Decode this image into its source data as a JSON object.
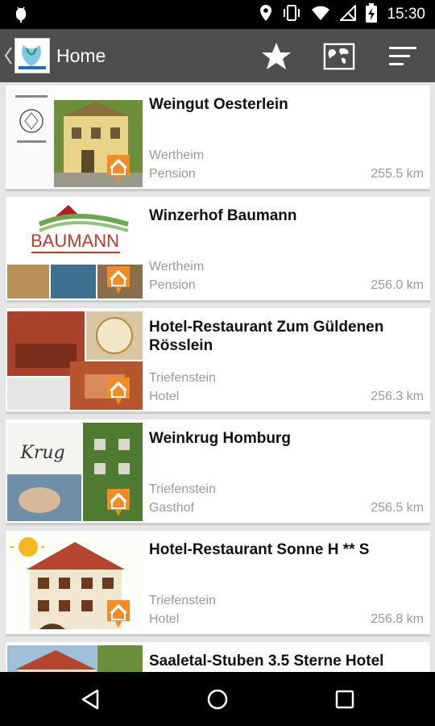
{
  "status_bar": {
    "time": "15:30",
    "icons": [
      "android-debug-icon",
      "location-icon",
      "vibrate-icon",
      "wifi-icon",
      "no-signal-icon",
      "battery-charging-icon"
    ]
  },
  "app_bar": {
    "back_icon": "chevron-left-icon",
    "title": "Home",
    "actions": [
      "star-icon",
      "map-icon",
      "sort-icon"
    ]
  },
  "listings": [
    {
      "name": "Weingut Oesterlein",
      "city": "Wertheim",
      "type": "Pension",
      "distance": "255.5 km"
    },
    {
      "name": "Winzerhof Baumann",
      "city": "Wertheim",
      "type": "Pension",
      "distance": "256.0 km"
    },
    {
      "name": "Hotel-Restaurant Zum Güldenen Rösslein",
      "city": "Triefenstein",
      "type": "Hotel",
      "distance": "256.3 km"
    },
    {
      "name": "Weinkrug Homburg",
      "city": "Triefenstein",
      "type": "Gasthof",
      "distance": "256.5 km"
    },
    {
      "name": "Hotel-Restaurant Sonne H ** S",
      "city": "Triefenstein",
      "type": "Hotel",
      "distance": "256.8 km"
    },
    {
      "name": "Saaletal-Stuben 3.5 Sterne Hotel",
      "city": "",
      "type": "",
      "distance": ""
    }
  ],
  "thumb_text": {
    "baumann_brand": "BAUMANN",
    "krug": "Krug"
  },
  "colors": {
    "app_bar": "#4e4e4e",
    "pin": "#f28c28",
    "title_text": "#111111",
    "secondary_text": "#9a9a9a"
  },
  "nav_bar": {
    "buttons": [
      "back-triangle-icon",
      "home-circle-icon",
      "recents-square-icon"
    ]
  }
}
